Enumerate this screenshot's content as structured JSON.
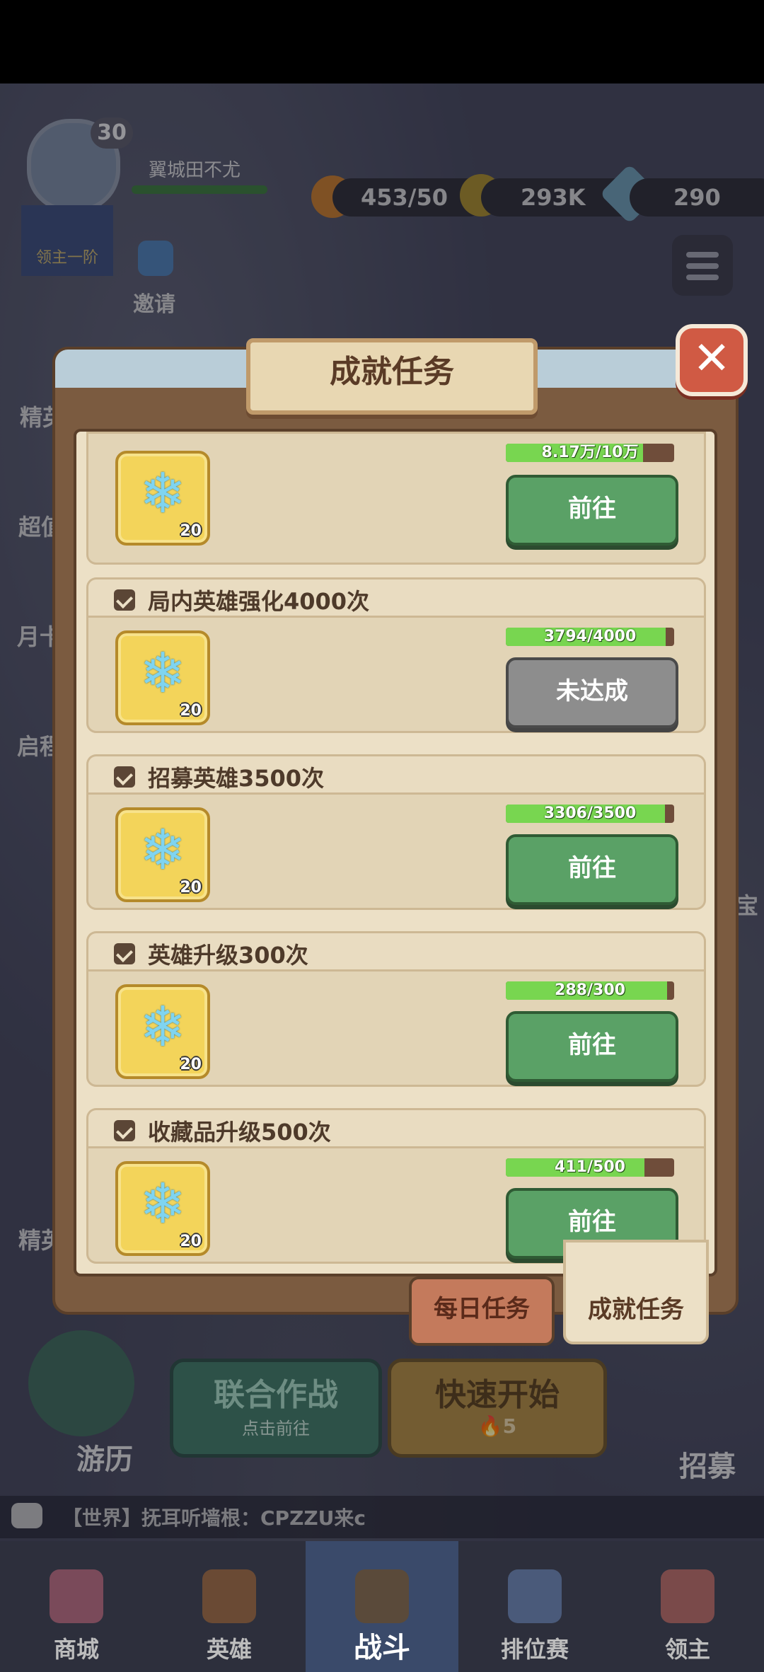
{
  "hud": {
    "level": "30",
    "player_name": "翼城田不尤",
    "rank": "领主一阶",
    "invite": "邀请",
    "energy": "453/50",
    "gold": "293K",
    "gems": "290"
  },
  "side": {
    "left": [
      "精英",
      "超值",
      "月卡",
      "启程",
      "精英"
    ],
    "right": "宝"
  },
  "modal": {
    "title": "成就任务",
    "close": "✕",
    "tasks": [
      {
        "title": "",
        "progress_text": "8.17万/10万",
        "progress": 0.817,
        "reward_qty": "20",
        "button": "前往",
        "enabled": true
      },
      {
        "title": "局内英雄强化4000次",
        "progress_text": "3794/4000",
        "progress": 0.9485,
        "reward_qty": "20",
        "button": "未达成",
        "enabled": false
      },
      {
        "title": "招募英雄3500次",
        "progress_text": "3306/3500",
        "progress": 0.9446,
        "reward_qty": "20",
        "button": "前往",
        "enabled": true
      },
      {
        "title": "英雄升级300次",
        "progress_text": "288/300",
        "progress": 0.96,
        "reward_qty": "20",
        "button": "前往",
        "enabled": true
      },
      {
        "title": "收藏品升级500次",
        "progress_text": "411/500",
        "progress": 0.822,
        "reward_qty": "20",
        "button": "前往",
        "enabled": true
      }
    ],
    "tabs": {
      "daily": "每日任务",
      "achievement": "成就任务"
    }
  },
  "home": {
    "coop_title": "联合作战",
    "coop_sub": "点击前往",
    "quick_title": "快速开始",
    "quick_cost": "🔥5",
    "travel": "游历",
    "recruit": "招募",
    "chat": "【世界】抚耳听墙根：CPZZU来c"
  },
  "nav": [
    "商城",
    "英雄",
    "战斗",
    "排位赛",
    "领主"
  ],
  "colors": {
    "accent_green": "#5aa166",
    "progress_green": "#78d650",
    "panel": "#ece0c6",
    "close_red": "#d05a44"
  }
}
